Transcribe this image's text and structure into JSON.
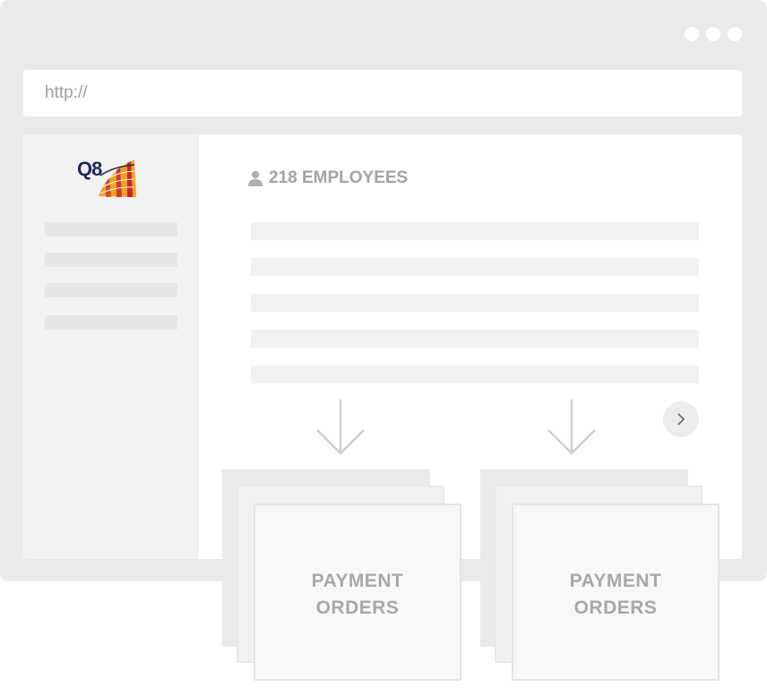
{
  "browser": {
    "window_controls": [
      "dot",
      "dot",
      "dot"
    ],
    "url": "http://"
  },
  "sidebar": {
    "logo_text": "Q8"
  },
  "main": {
    "employees_label": "218 EMPLOYEES",
    "person_icon": "user-icon",
    "next_icon": "chevron-right-icon"
  },
  "stacks": [
    {
      "line1": "PAYMENT",
      "line2": "ORDERS"
    },
    {
      "line1": "PAYMENT",
      "line2": "ORDERS"
    }
  ],
  "colors": {
    "window_bg": "#e9e9e9",
    "placeholder": "#f2f2f2",
    "text_gray": "#a3a3a3",
    "logo_navy": "#1b2a5a",
    "logo_orange": "#f0a020",
    "logo_red": "#c8232c"
  }
}
